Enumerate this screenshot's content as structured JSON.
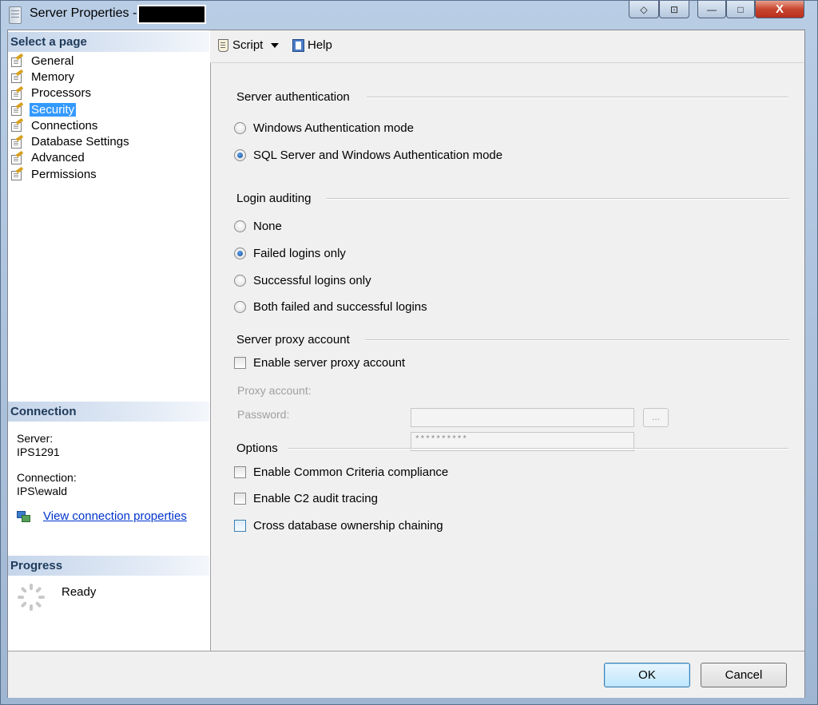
{
  "window": {
    "title": "Server Properties -",
    "controls": {
      "help_glyph": "◇",
      "restore_glyph": "⊡",
      "minimize_glyph": "—",
      "maximize_glyph": "□",
      "close_glyph": "X"
    }
  },
  "sidebar": {
    "select_page_header": "Select a page",
    "pages": [
      {
        "label": "General",
        "icon": "page-properties-icon"
      },
      {
        "label": "Memory",
        "icon": "page-properties-icon"
      },
      {
        "label": "Processors",
        "icon": "page-properties-icon"
      },
      {
        "label": "Security",
        "icon": "page-properties-icon",
        "selected": true
      },
      {
        "label": "Connections",
        "icon": "page-properties-icon"
      },
      {
        "label": "Database Settings",
        "icon": "page-properties-icon"
      },
      {
        "label": "Advanced",
        "icon": "page-properties-icon"
      },
      {
        "label": "Permissions",
        "icon": "page-properties-icon"
      }
    ],
    "connection_header": "Connection",
    "server_label": "Server:",
    "server_value": "IPS1291",
    "connection_label": "Connection:",
    "connection_value": "IPS\\ewald",
    "view_connection_link": "View connection properties",
    "progress_header": "Progress",
    "progress_status": "Ready"
  },
  "toolbar": {
    "script_label": "Script",
    "help_label": "Help"
  },
  "security": {
    "server_auth": {
      "title": "Server authentication",
      "options": [
        {
          "label": "Windows Authentication mode",
          "checked": false
        },
        {
          "label": "SQL Server and Windows Authentication mode",
          "checked": true
        }
      ]
    },
    "login_auditing": {
      "title": "Login auditing",
      "options": [
        {
          "label": "None",
          "checked": false
        },
        {
          "label": "Failed logins only",
          "checked": true
        },
        {
          "label": "Successful logins only",
          "checked": false
        },
        {
          "label": "Both failed and successful logins",
          "checked": false
        }
      ]
    },
    "proxy": {
      "title": "Server proxy account",
      "enable_label": "Enable server proxy account",
      "enable_checked": false,
      "proxy_account_label": "Proxy account:",
      "proxy_account_value": "",
      "browse_label": "...",
      "password_label": "Password:",
      "password_value": "**********"
    },
    "options": {
      "title": "Options",
      "items": [
        {
          "label": "Enable Common Criteria compliance",
          "checked": false
        },
        {
          "label": "Enable C2 audit tracing",
          "checked": false
        },
        {
          "label": "Cross database ownership chaining",
          "checked": false
        }
      ]
    }
  },
  "footer": {
    "ok_label": "OK",
    "cancel_label": "Cancel"
  }
}
